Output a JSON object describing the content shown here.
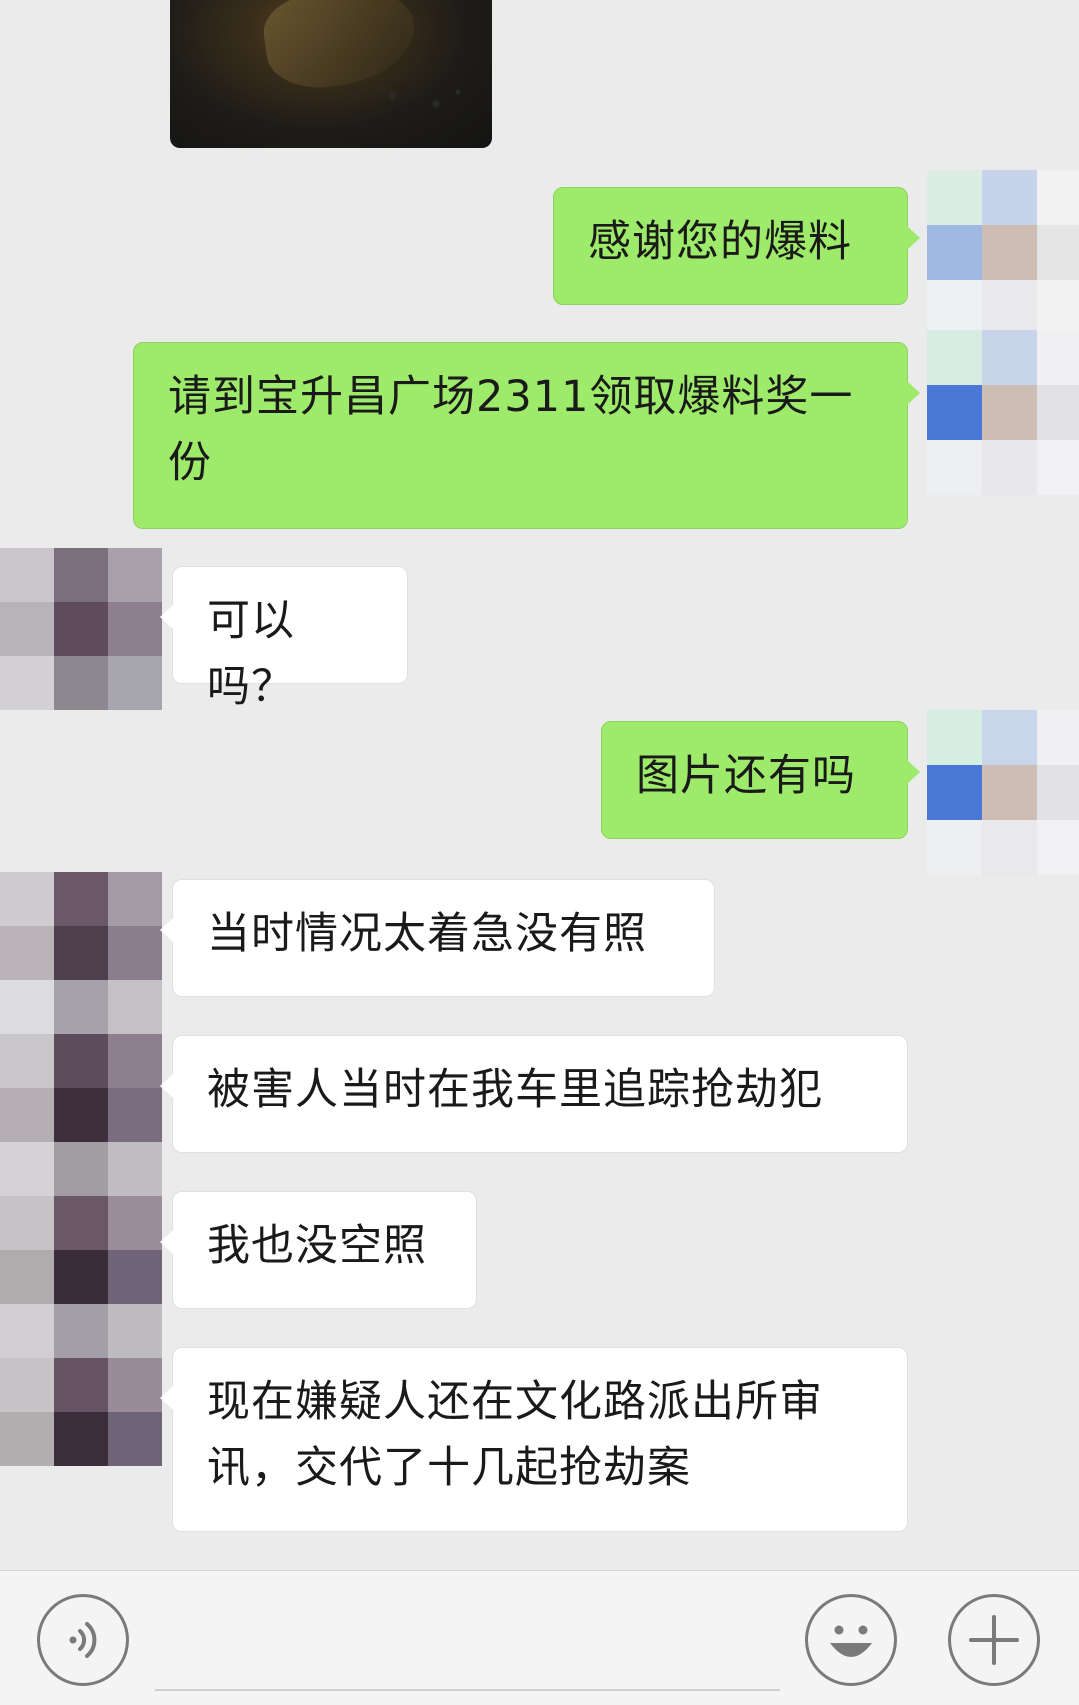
{
  "messages": [
    {
      "side": "in",
      "type": "image",
      "alt": ""
    },
    {
      "side": "out",
      "text": "感谢您的爆料"
    },
    {
      "side": "out",
      "text": "请到宝升昌广场2311领取爆料奖一份"
    },
    {
      "side": "in",
      "text": "可以吗？"
    },
    {
      "side": "out",
      "text": "图片还有吗"
    },
    {
      "side": "in",
      "text": "当时情况太着急没有照"
    },
    {
      "side": "in",
      "text": "被害人当时在我车里追踪抢劫犯"
    },
    {
      "side": "in",
      "text": "我也没空照"
    },
    {
      "side": "in",
      "text": "现在嫌疑人还在文化路派出所审讯，交代了十几起抢劫案"
    }
  ],
  "colors": {
    "background": "#ebebeb",
    "outgoing_bubble": "#9eea6a",
    "incoming_bubble": "#ffffff",
    "icon": "#7a7a7a"
  },
  "input_bar": {
    "left_icon": "voice-icon",
    "right_icons": [
      "emoji-icon",
      "plus-icon"
    ],
    "text_value": ""
  }
}
